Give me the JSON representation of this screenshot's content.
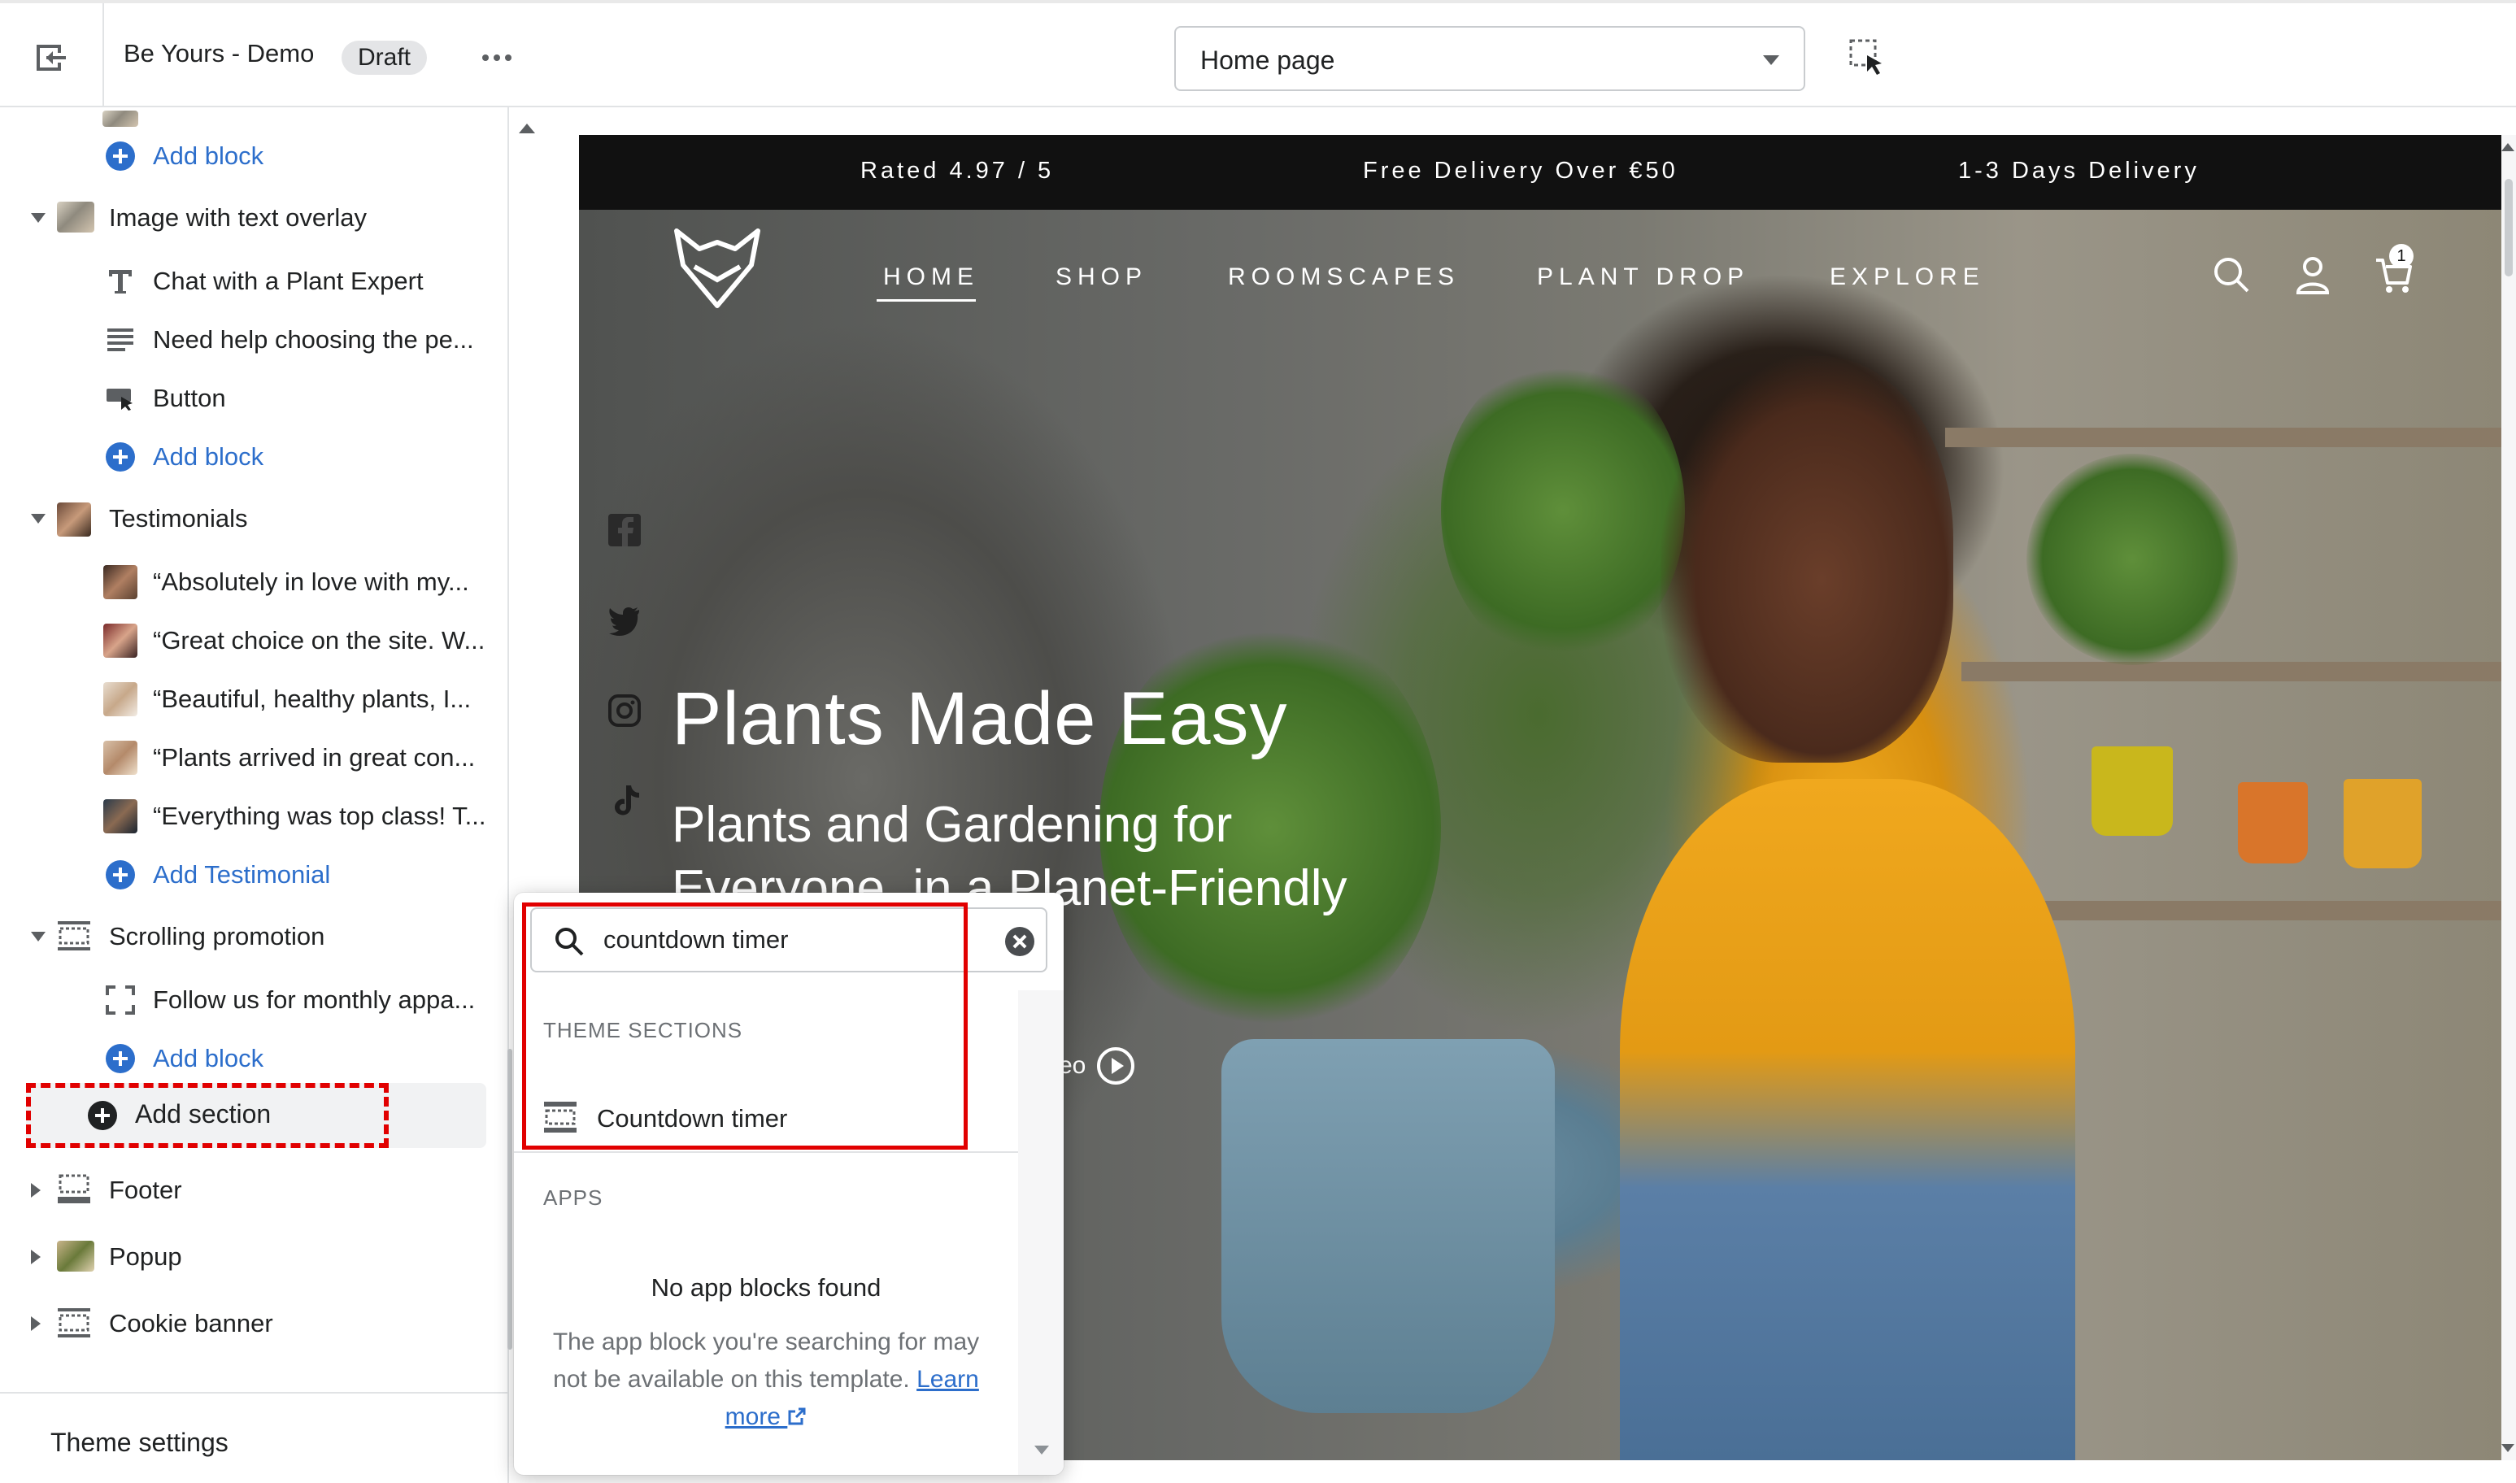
{
  "topbar": {
    "store_name": "Be Yours - Demo",
    "status_badge": "Draft",
    "page_select": "Home page"
  },
  "sidebar": {
    "add_block_label": "Add block",
    "sections": {
      "image_overlay": {
        "label": "Image with text overlay",
        "blocks": [
          "Chat with a Plant Expert",
          "Need help choosing the pe...",
          "Button"
        ]
      },
      "testimonials": {
        "label": "Testimonials",
        "blocks": [
          "“Absolutely in love with my...",
          "“Great choice on the site. W...",
          "“Beautiful, healthy plants, I...",
          "“Plants arrived in great con...",
          "“Everything was top class! T..."
        ],
        "add_label": "Add Testimonial"
      },
      "scrolling_promotion": {
        "label": "Scrolling promotion",
        "blocks": [
          "Follow us for monthly appa..."
        ]
      },
      "footer": {
        "label": "Footer"
      },
      "popup": {
        "label": "Popup"
      },
      "cookie_banner": {
        "label": "Cookie banner"
      }
    },
    "add_section_label": "Add section",
    "theme_settings_label": "Theme settings"
  },
  "preview": {
    "announcements": [
      "Rated 4.97 / 5",
      "Free Delivery Over €50",
      "1-3 Days Delivery"
    ],
    "nav": [
      "HOME",
      "SHOP",
      "ROOMSCAPES",
      "PLANT DROP",
      "EXPLORE"
    ],
    "cart_count": "1",
    "hero_title": "Plants Made Easy",
    "hero_subtitle": "Plants and Gardening for Everyone, in a Planet-Friendly",
    "hero_video_label": "eo"
  },
  "popover": {
    "search_value": "countdown timer",
    "theme_sections_heading": "THEME SECTIONS",
    "result_label": "Countdown timer",
    "apps_heading": "APPS",
    "empty_title": "No app blocks found",
    "empty_body": "The app block you're searching for may not be available on this template.",
    "learn_more_label": "Learn more"
  },
  "colors": {
    "accent_blue": "#2c6ecb",
    "highlight_red": "#e10000",
    "announcement_bg": "#111111"
  }
}
